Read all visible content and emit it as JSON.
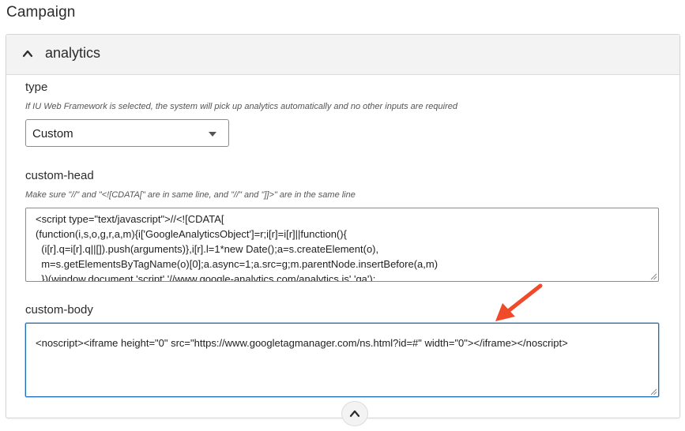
{
  "page": {
    "heading": "Campaign"
  },
  "panel": {
    "title": "analytics",
    "fields": {
      "type": {
        "label": "type",
        "hint": "If IU Web Framework is selected, the system will pick up analytics automatically and no other inputs are required",
        "selected": "Custom"
      },
      "custom_head": {
        "label": "custom-head",
        "hint": "Make sure \"//\" and \"<![CDATA[\" are in same line, and \"//\" and \"]]>\" are in the same line",
        "lines": [
          "<script type=\"text/javascript\">//<![CDATA[",
          "(function(i,s,o,g,r,a,m){i['GoogleAnalyticsObject']=r;i[r]=i[r]||function(){",
          "  (i[r].q=i[r].q||[]).push(arguments)},i[r].l=1*new Date();a=s.createElement(o),",
          "  m=s.getElementsByTagName(o)[0];a.async=1;a.src=g;m.parentNode.insertBefore(a,m)",
          "  })(window,document,'script','//www.google-analytics.com/analytics.js','ga');"
        ]
      },
      "custom_body": {
        "label": "custom-body",
        "value": "<noscript><iframe height=\"0\" src=\"https://www.googletagmanager.com/ns.html?id=#\" width=\"0\"></iframe></noscript>"
      }
    }
  },
  "icons": {
    "header_toggle": "chevron-up-icon",
    "collapse": "chevron-up-icon",
    "annotation": "red-arrow-icon",
    "resize": "resize-grip-icon"
  },
  "colors": {
    "annotation_arrow": "#f04a2a",
    "focus_border": "#1f6fb8",
    "header_bg": "#f3f3f3"
  }
}
